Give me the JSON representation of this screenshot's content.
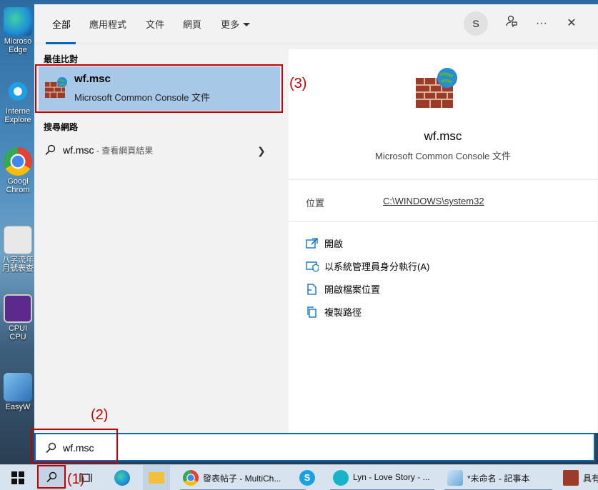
{
  "desktop": {
    "icons": [
      {
        "label": "Microso Edge",
        "color": "#1f8fd6",
        "icon": "edge-icon"
      },
      {
        "label": "Interne Explore",
        "color": "#1ea0e6",
        "icon": "ie-icon"
      },
      {
        "label": "Googl Chrom",
        "color": "#e34133",
        "icon": "chrome-icon"
      },
      {
        "label": "八字流年 月號表查",
        "color": "#d8d8d8",
        "icon": "settings-app-icon"
      },
      {
        "label": "CPUI CPU",
        "color": "#5b2a8c",
        "icon": "cpu-icon"
      },
      {
        "label": "EasyW",
        "color": "#2d6fb5",
        "icon": "easy-icon"
      }
    ]
  },
  "tabs": [
    {
      "label": "全部"
    },
    {
      "label": "應用程式"
    },
    {
      "label": "文件"
    },
    {
      "label": "網頁"
    },
    {
      "label": "更多"
    }
  ],
  "header": {
    "avatar_letter": "S",
    "more_glyph": "···",
    "close_glyph": "✕"
  },
  "best_match": {
    "section": "最佳比對",
    "title": "wf.msc",
    "subtitle": "Microsoft Common Console 文件"
  },
  "web": {
    "section": "搜尋網路",
    "query": "wf.msc",
    "suffix": " - 查看網頁結果"
  },
  "preview": {
    "title": "wf.msc",
    "subtitle": "Microsoft Common Console 文件",
    "location_label": "位置",
    "location_path": "C:\\WINDOWS\\system32",
    "actions": [
      {
        "label": "開啟",
        "icon": "open-icon"
      },
      {
        "label": "以系統管理員身分執行(A)",
        "icon": "shield-icon"
      },
      {
        "label": "開啟檔案位置",
        "icon": "file-location-icon"
      },
      {
        "label": "複製路徑",
        "icon": "copy-icon"
      }
    ]
  },
  "search": {
    "value": "wf.msc"
  },
  "taskbar": {
    "apps": [
      {
        "label": "發表帖子 - MultiCh...",
        "icon": "chrome-icon",
        "color": "#e34133"
      },
      {
        "label": "Lyn - Love Story - ...",
        "icon": "kkbox-icon",
        "color": "#19b3c8"
      },
      {
        "label": "*未命名 - 記事本",
        "icon": "notepad-icon",
        "color": "#6aa8d8"
      },
      {
        "label": "具有",
        "icon": "firewall-icon",
        "color": "#9b3b2a"
      }
    ]
  },
  "annotations": {
    "one": "(1)",
    "two": "(2)",
    "three": "(3)"
  },
  "colors": {
    "accent": "#0067c0",
    "highlight": "#a7c8e6",
    "annotation": "#c00000"
  }
}
